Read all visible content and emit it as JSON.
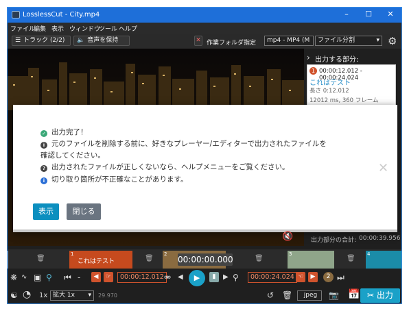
{
  "window": {
    "title": "LosslessCut - City.mp4"
  },
  "menu": [
    "ファイル",
    "編集",
    "表示",
    "ウィンドウ",
    "ツール",
    "ヘルプ"
  ],
  "toolbar": {
    "tracks": "トラック (2/2)",
    "audio": "音声を保持",
    "workdir": "作業フォルダ指定",
    "format": "mp4 - MP4 (M",
    "mode": "ファイル分割"
  },
  "side": {
    "header": "出力する部分:",
    "seg_index": "1",
    "seg_range": "00:00:12.012 - 00:00:24.024",
    "seg_name": "これはテスト",
    "seg_length": "長さ 0:12.012",
    "seg_frames": "12012 ms, 360 フレーム",
    "total_label": "出力部分の合計:",
    "total_value": "00:00:39.956"
  },
  "modal": {
    "lines": [
      "出力完了！",
      "元のファイルを削除する前に、好きなプレーヤー/エディターで出力されたファイルを",
      "確認してください。",
      "出力されたファイルが正しくないなら、ヘルプメニューをご覧ください。",
      "切り取り箇所が不正確なことがあります。"
    ],
    "show_btn": "表示",
    "close_btn": "閉じる",
    "colors": {
      "success": "#3aa878",
      "show": "#0c8fbf",
      "close": "#6a7480"
    }
  },
  "timeline": {
    "seg1_num": "1",
    "seg1_label": "これはテスト",
    "seg2_num": "2",
    "time_display": "00:00:00.000",
    "seg3_num": "3",
    "seg4_num": "4"
  },
  "controls": {
    "minus": "-",
    "start_time": "00:00:12.012",
    "end_time": "00:00:24.024",
    "seg_badge": "2"
  },
  "bottom": {
    "rate": "1x",
    "zoom": "拡大 1x",
    "fps": "29.970",
    "fmt": "jpeg",
    "export": "出力"
  }
}
